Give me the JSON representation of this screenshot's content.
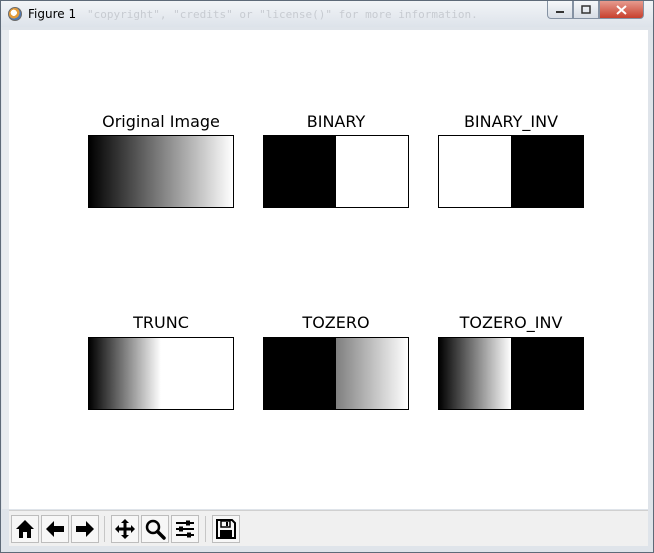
{
  "window": {
    "title": "Figure 1",
    "background_text": "\"copyright\", \"credits\" or \"license()\" for more information."
  },
  "figure": {
    "panels": [
      {
        "title": "Original Image",
        "gradient": "linear-gradient(to right, #000 0%, #ffffff 100%)"
      },
      {
        "title": "BINARY",
        "gradient": "linear-gradient(to right, #000 0%, #000 50%, #fff 50%, #fff 100%)"
      },
      {
        "title": "BINARY_INV",
        "gradient": "linear-gradient(to right, #fff 0%, #fff 50%, #000 50%, #000 100%)"
      },
      {
        "title": "TRUNC",
        "gradient": "linear-gradient(to right, #000 0%, #ffffff 50%, #ffffff 100%)"
      },
      {
        "title": "TOZERO",
        "gradient": "linear-gradient(to right, #000 0%, #000 50%, #7f7f7f 50%, #ffffff 100%)"
      },
      {
        "title": "TOZERO_INV",
        "gradient": "linear-gradient(to right, #000 0%, #ffffff 50%, #000 50%, #000 100%)"
      }
    ]
  },
  "toolbar": {
    "buttons": [
      {
        "name": "home-icon"
      },
      {
        "name": "back-arrow-icon"
      },
      {
        "name": "forward-arrow-icon"
      },
      {
        "name": "pan-icon"
      },
      {
        "name": "zoom-icon"
      },
      {
        "name": "configure-subplots-icon"
      },
      {
        "name": "save-icon"
      }
    ]
  }
}
